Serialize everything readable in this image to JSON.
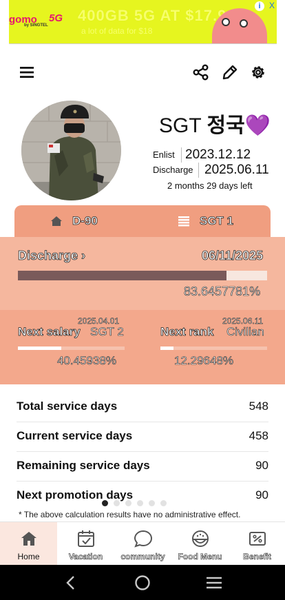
{
  "ad": {
    "brand": "gomo",
    "brand_sub": "by SINGTEL",
    "network": "5G",
    "headline": "400GB 5G AT $17.99",
    "subline": "a lot of data for $18",
    "info_label": "i",
    "close_label": "X"
  },
  "toolbar": {
    "menu_icon": "hamburger-icon",
    "share_icon": "share-icon",
    "edit_icon": "pencil-icon",
    "settings_icon": "gear-icon"
  },
  "profile": {
    "rank": "SGT",
    "name": "정국💜",
    "enlist_label": "Enlist",
    "enlist_date": "2023.12.12",
    "discharge_label": "Discharge",
    "discharge_date": "2025.06.11",
    "remaining_text": "2 months 29 days left"
  },
  "tabs": [
    {
      "label": "D-90",
      "icon": "home-icon"
    },
    {
      "label": "SGT 1",
      "icon": "rank-stripes-icon"
    }
  ],
  "discharge_panel": {
    "label": "Discharge",
    "chevron": "›",
    "date": "06/11/2025",
    "percent_text": "83.6457781%",
    "progress": 0.836457781,
    "fill_color": "#7a5a5a"
  },
  "next_salary": {
    "date": "2025.04.01",
    "label": "Next salary",
    "target": "SGT 2",
    "percent_text": "40.45938%",
    "progress": 0.4045938
  },
  "next_rank": {
    "date": "2025.06.11",
    "label": "Next rank",
    "target": "Civilian",
    "percent_text": "12.29648%",
    "progress": 0.1229648
  },
  "stats": [
    {
      "label": "Total service days",
      "value": "548"
    },
    {
      "label": "Current service days",
      "value": "458"
    },
    {
      "label": "Remaining service days",
      "value": "90"
    },
    {
      "label": "Next promotion days",
      "value": "90"
    }
  ],
  "page_indicator": {
    "count": 6,
    "active": 0
  },
  "disclaimer": "* The above calculation results have no administrative effect.",
  "bottom_nav": [
    {
      "label": "Home",
      "icon": "home-icon",
      "active": true
    },
    {
      "label": "Vacation",
      "icon": "calendar-check-icon",
      "active": false
    },
    {
      "label": "community",
      "icon": "chat-bubble-icon",
      "active": false
    },
    {
      "label": "Food Menu",
      "icon": "rice-bowl-icon",
      "active": false
    },
    {
      "label": "Benefit",
      "icon": "coupon-icon",
      "active": false
    }
  ],
  "system_nav": {
    "back_icon": "back-chevron-icon",
    "home_icon": "circle-home-icon",
    "recents_icon": "recents-lines-icon"
  },
  "colors": {
    "accent": "#f09e80",
    "discharge_bg": "#f5b79e",
    "next_bg": "#f3a88c",
    "nav_active_bg": "#fbe7df",
    "heart": "#8a2be2"
  }
}
